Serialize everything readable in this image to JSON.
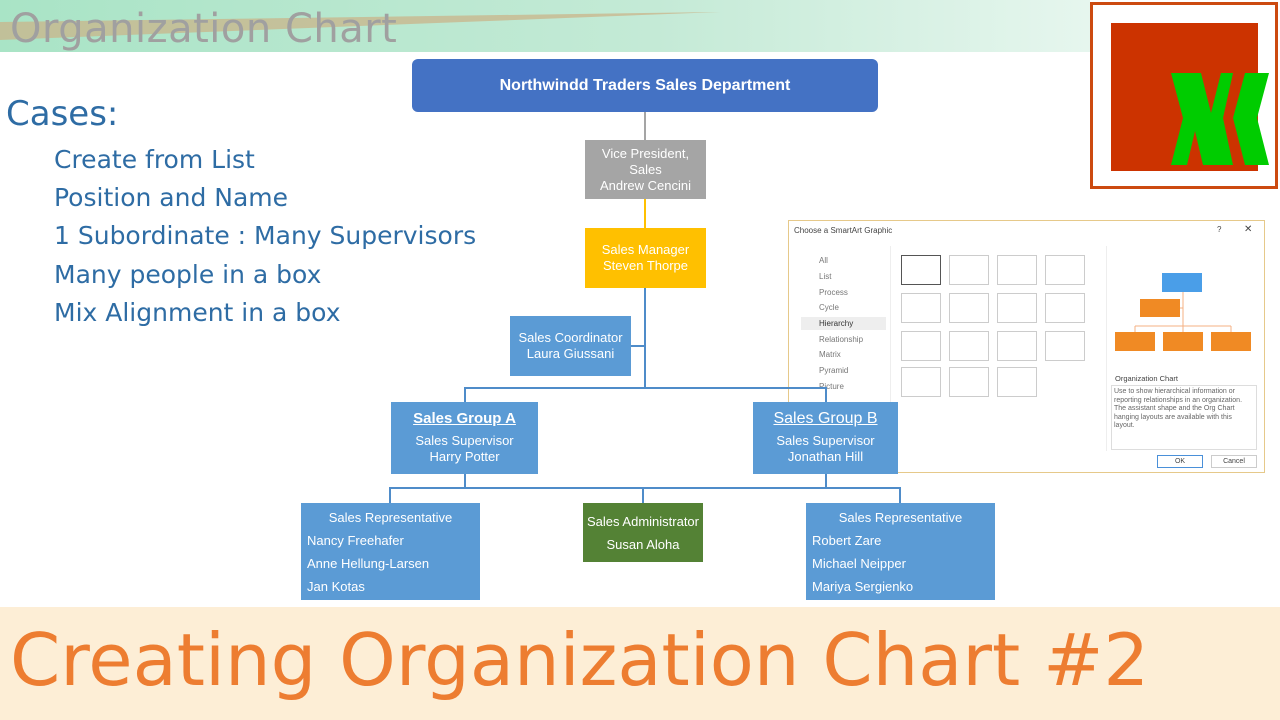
{
  "header": {
    "title": "Organization Chart"
  },
  "cases": {
    "heading": "Cases:",
    "items": [
      "Create from List",
      "Position and Name",
      "1 Subordinate : Many Supervisors",
      "Many people in a box",
      "Mix Alignment in a box"
    ]
  },
  "org": {
    "top": "Northwindd Traders Sales Department",
    "vp": {
      "title": "Vice President,",
      "title2": "Sales",
      "name": "Andrew Cencini"
    },
    "manager": {
      "title": "Sales Manager",
      "name": "Steven Thorpe"
    },
    "coordinator": {
      "title": "Sales Coordinator",
      "name": "Laura Giussani"
    },
    "groupA": {
      "group": "Sales Group A",
      "title": "Sales Supervisor",
      "name": "Harry Potter"
    },
    "groupB": {
      "group": "Sales Group B",
      "title": "Sales Supervisor",
      "name": "Jonathan Hill"
    },
    "repsA": {
      "title": "Sales Representative",
      "names": [
        "Nancy Freehafer",
        "Anne Hellung-Larsen",
        "Jan Kotas"
      ]
    },
    "admin": {
      "title": "Sales Administrator",
      "name": "Susan Aloha"
    },
    "repsB": {
      "title": "Sales Representative",
      "names": [
        "Robert Zare",
        "Michael Neipper",
        "Mariya Sergienko"
      ]
    },
    "colors": {
      "top": "#4472c4",
      "vp": "#a5a5a5",
      "manager": "#ffc000",
      "blue": "#5b9bd5",
      "admin": "#548235"
    }
  },
  "dialog": {
    "title": "Choose a SmartArt Graphic",
    "help": "?",
    "close": "✕",
    "categories": [
      "All",
      "List",
      "Process",
      "Cycle",
      "Hierarchy",
      "Relationship",
      "Matrix",
      "Pyramid",
      "Picture"
    ],
    "selected": "Hierarchy",
    "preview_title": "Organization Chart",
    "description": "Use to show hierarchical information or reporting relationships in an organization. The assistant shape and the Org Chart hanging layouts are available with this layout.",
    "ok": "OK",
    "cancel": "Cancel"
  },
  "banner": {
    "title": "Creating Organization Chart #2"
  },
  "logo": {
    "text": "X",
    "colors": [
      "#cc3300",
      "#00cc00"
    ]
  }
}
